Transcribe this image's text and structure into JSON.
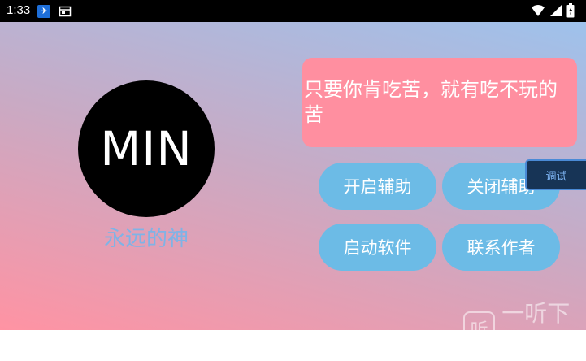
{
  "status_bar": {
    "time": "1:33",
    "icons": [
      "app-notification-icon",
      "document-icon",
      "wifi-icon",
      "signal-icon",
      "battery-icon"
    ]
  },
  "main": {
    "avatar_text": "MIN",
    "subtitle": "永远的神",
    "quote": "只要你肯吃苦，就有吃不玩的苦",
    "buttons": {
      "open_assist": "开启辅助",
      "close_assist": "关闭辅助",
      "start_software": "启动软件",
      "contact_author": "联系作者"
    },
    "debug_tab": "调试"
  },
  "watermark": {
    "logo": "听",
    "text": "一听下载"
  },
  "colors": {
    "quote_bg": "#ff8fa0",
    "button_bg": "#6cbbe6",
    "subtitle": "#7fb3e6",
    "debug_bg": "#173456"
  }
}
